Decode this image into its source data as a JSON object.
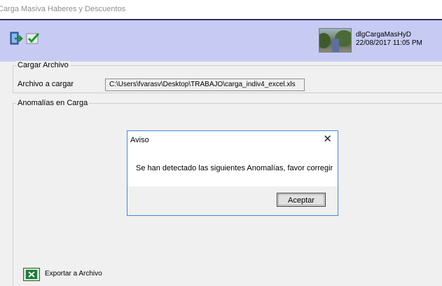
{
  "window": {
    "title": "Carga Masiva Haberes y Descuentos"
  },
  "toolbar": {
    "exit_icon": "exit-door-icon",
    "confirm_icon": "checkmark-icon",
    "form_name": "dlgCargaMasHyD",
    "datetime": "22/08/2017 11:05 PM"
  },
  "cargar_archivo": {
    "group_title": "Cargar Archivo",
    "label": "Archivo a cargar",
    "path": "C:\\Users\\fvarasv\\Desktop\\TRABAJO\\carga_indiv4_excel.xls"
  },
  "anomalias": {
    "group_title": "Anomalías en Carga"
  },
  "dialog": {
    "title": "Aviso",
    "close": "✕",
    "message": "Se han detectado las siguientes Anomalías, favor corregir",
    "button": "Aceptar"
  },
  "export": {
    "label": "Exportar a Archivo",
    "icon": "excel-icon"
  },
  "colors": {
    "toolbar_bg": "#c7cbf4",
    "dialog_border": "#3f8bd6",
    "panel_bg": "#f0f0f0"
  }
}
